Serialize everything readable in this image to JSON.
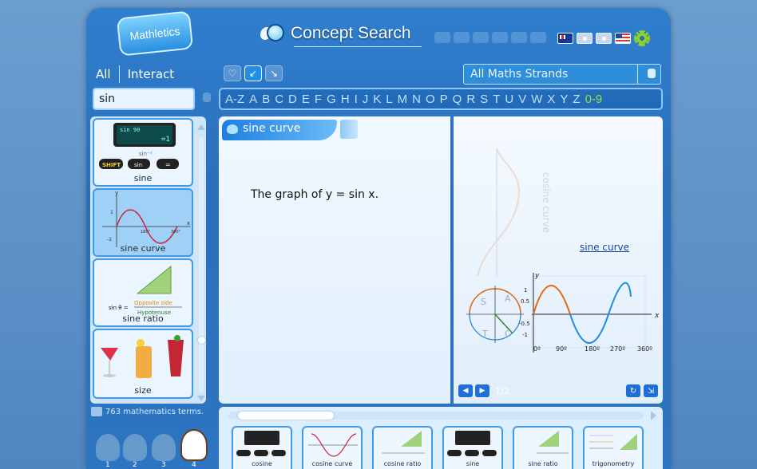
{
  "app": {
    "logo_text": "Mathletics",
    "title": "Concept Search"
  },
  "tabs": {
    "all": "All",
    "interact": "Interact"
  },
  "strand": {
    "value": "All Maths Strands"
  },
  "search": {
    "value": "sin"
  },
  "alphabet": [
    "A-Z",
    "A",
    "B",
    "C",
    "D",
    "E",
    "F",
    "G",
    "H",
    "I",
    "J",
    "K",
    "L",
    "M",
    "N",
    "O",
    "P",
    "Q",
    "R",
    "S",
    "T",
    "U",
    "V",
    "W",
    "X",
    "Y",
    "Z",
    "0-9"
  ],
  "results": [
    {
      "label": "sine",
      "calc_display": "sin 90",
      "calc_result": "=1",
      "inv": "sin⁻¹",
      "keys": [
        "SHIFT",
        "sin",
        "="
      ]
    },
    {
      "label": "sine curve"
    },
    {
      "label": "sine ratio",
      "formula_lhs": "sin θ =",
      "numerator": "Opposite side",
      "denominator": "Hypotenuse"
    },
    {
      "label": "size"
    }
  ],
  "concept": {
    "heading": "sine curve",
    "definition": "The graph of y = sin x.",
    "link": "sine curve",
    "page": "1/2",
    "graph": {
      "rotated_label": "cosine curve",
      "y_axis": "y",
      "x_axis": "x",
      "y_ticks": [
        "1",
        "0.5",
        "-0.5",
        "-1"
      ],
      "x_ticks": [
        "0º",
        "90º",
        "180º",
        "270º",
        "360º"
      ],
      "circle_letters": [
        "S",
        "A",
        "T",
        "C"
      ]
    }
  },
  "footer": {
    "count_text": "763 mathematics terms.",
    "levels": [
      "1",
      "2",
      "3",
      "4"
    ]
  },
  "related": [
    {
      "label": "cosine"
    },
    {
      "label": "cosine curve"
    },
    {
      "label": "cosine ratio"
    },
    {
      "label": "sine"
    },
    {
      "label": "sine ratio"
    },
    {
      "label": "trigonometry"
    }
  ]
}
